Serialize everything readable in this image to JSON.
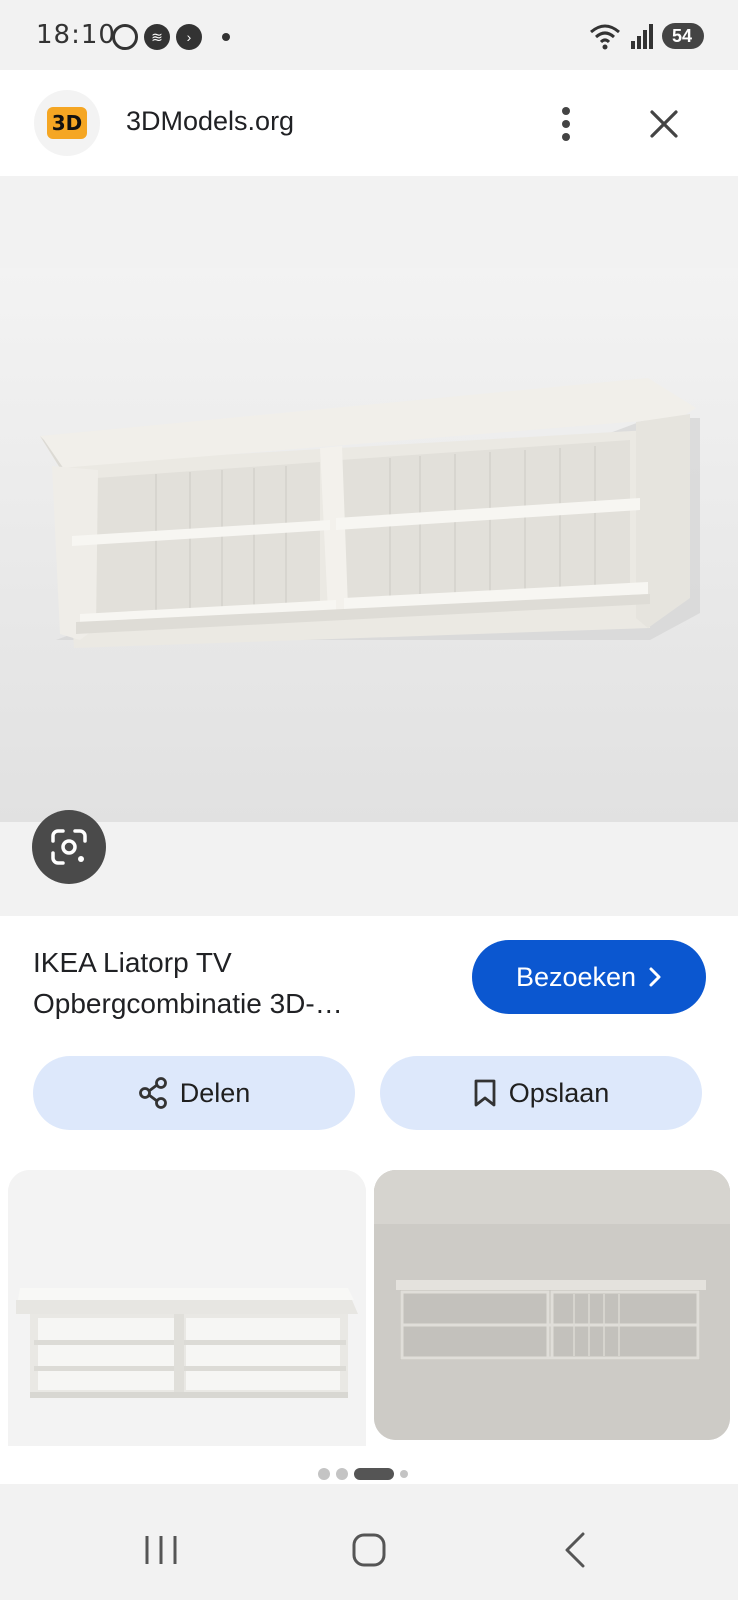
{
  "status_bar": {
    "time": "18:10",
    "battery": "54"
  },
  "header": {
    "logo_text": "3D",
    "site_name": "3DModels.org",
    "menu_icon": "more-vert-icon",
    "close_icon": "close-icon"
  },
  "main": {
    "lens_icon": "google-lens-icon"
  },
  "result": {
    "title": "IKEA Liatorp TV Opbergcombinatie 3D-…",
    "visit_label": "Bezoeken",
    "share_label": "Delen",
    "save_label": "Opslaan"
  },
  "carousel": {
    "total_dots": 4,
    "active_index": 2
  },
  "colors": {
    "primary_button": "#0b57d0",
    "pill_button": "#dde8fb",
    "logo_accent": "#f5a623"
  }
}
